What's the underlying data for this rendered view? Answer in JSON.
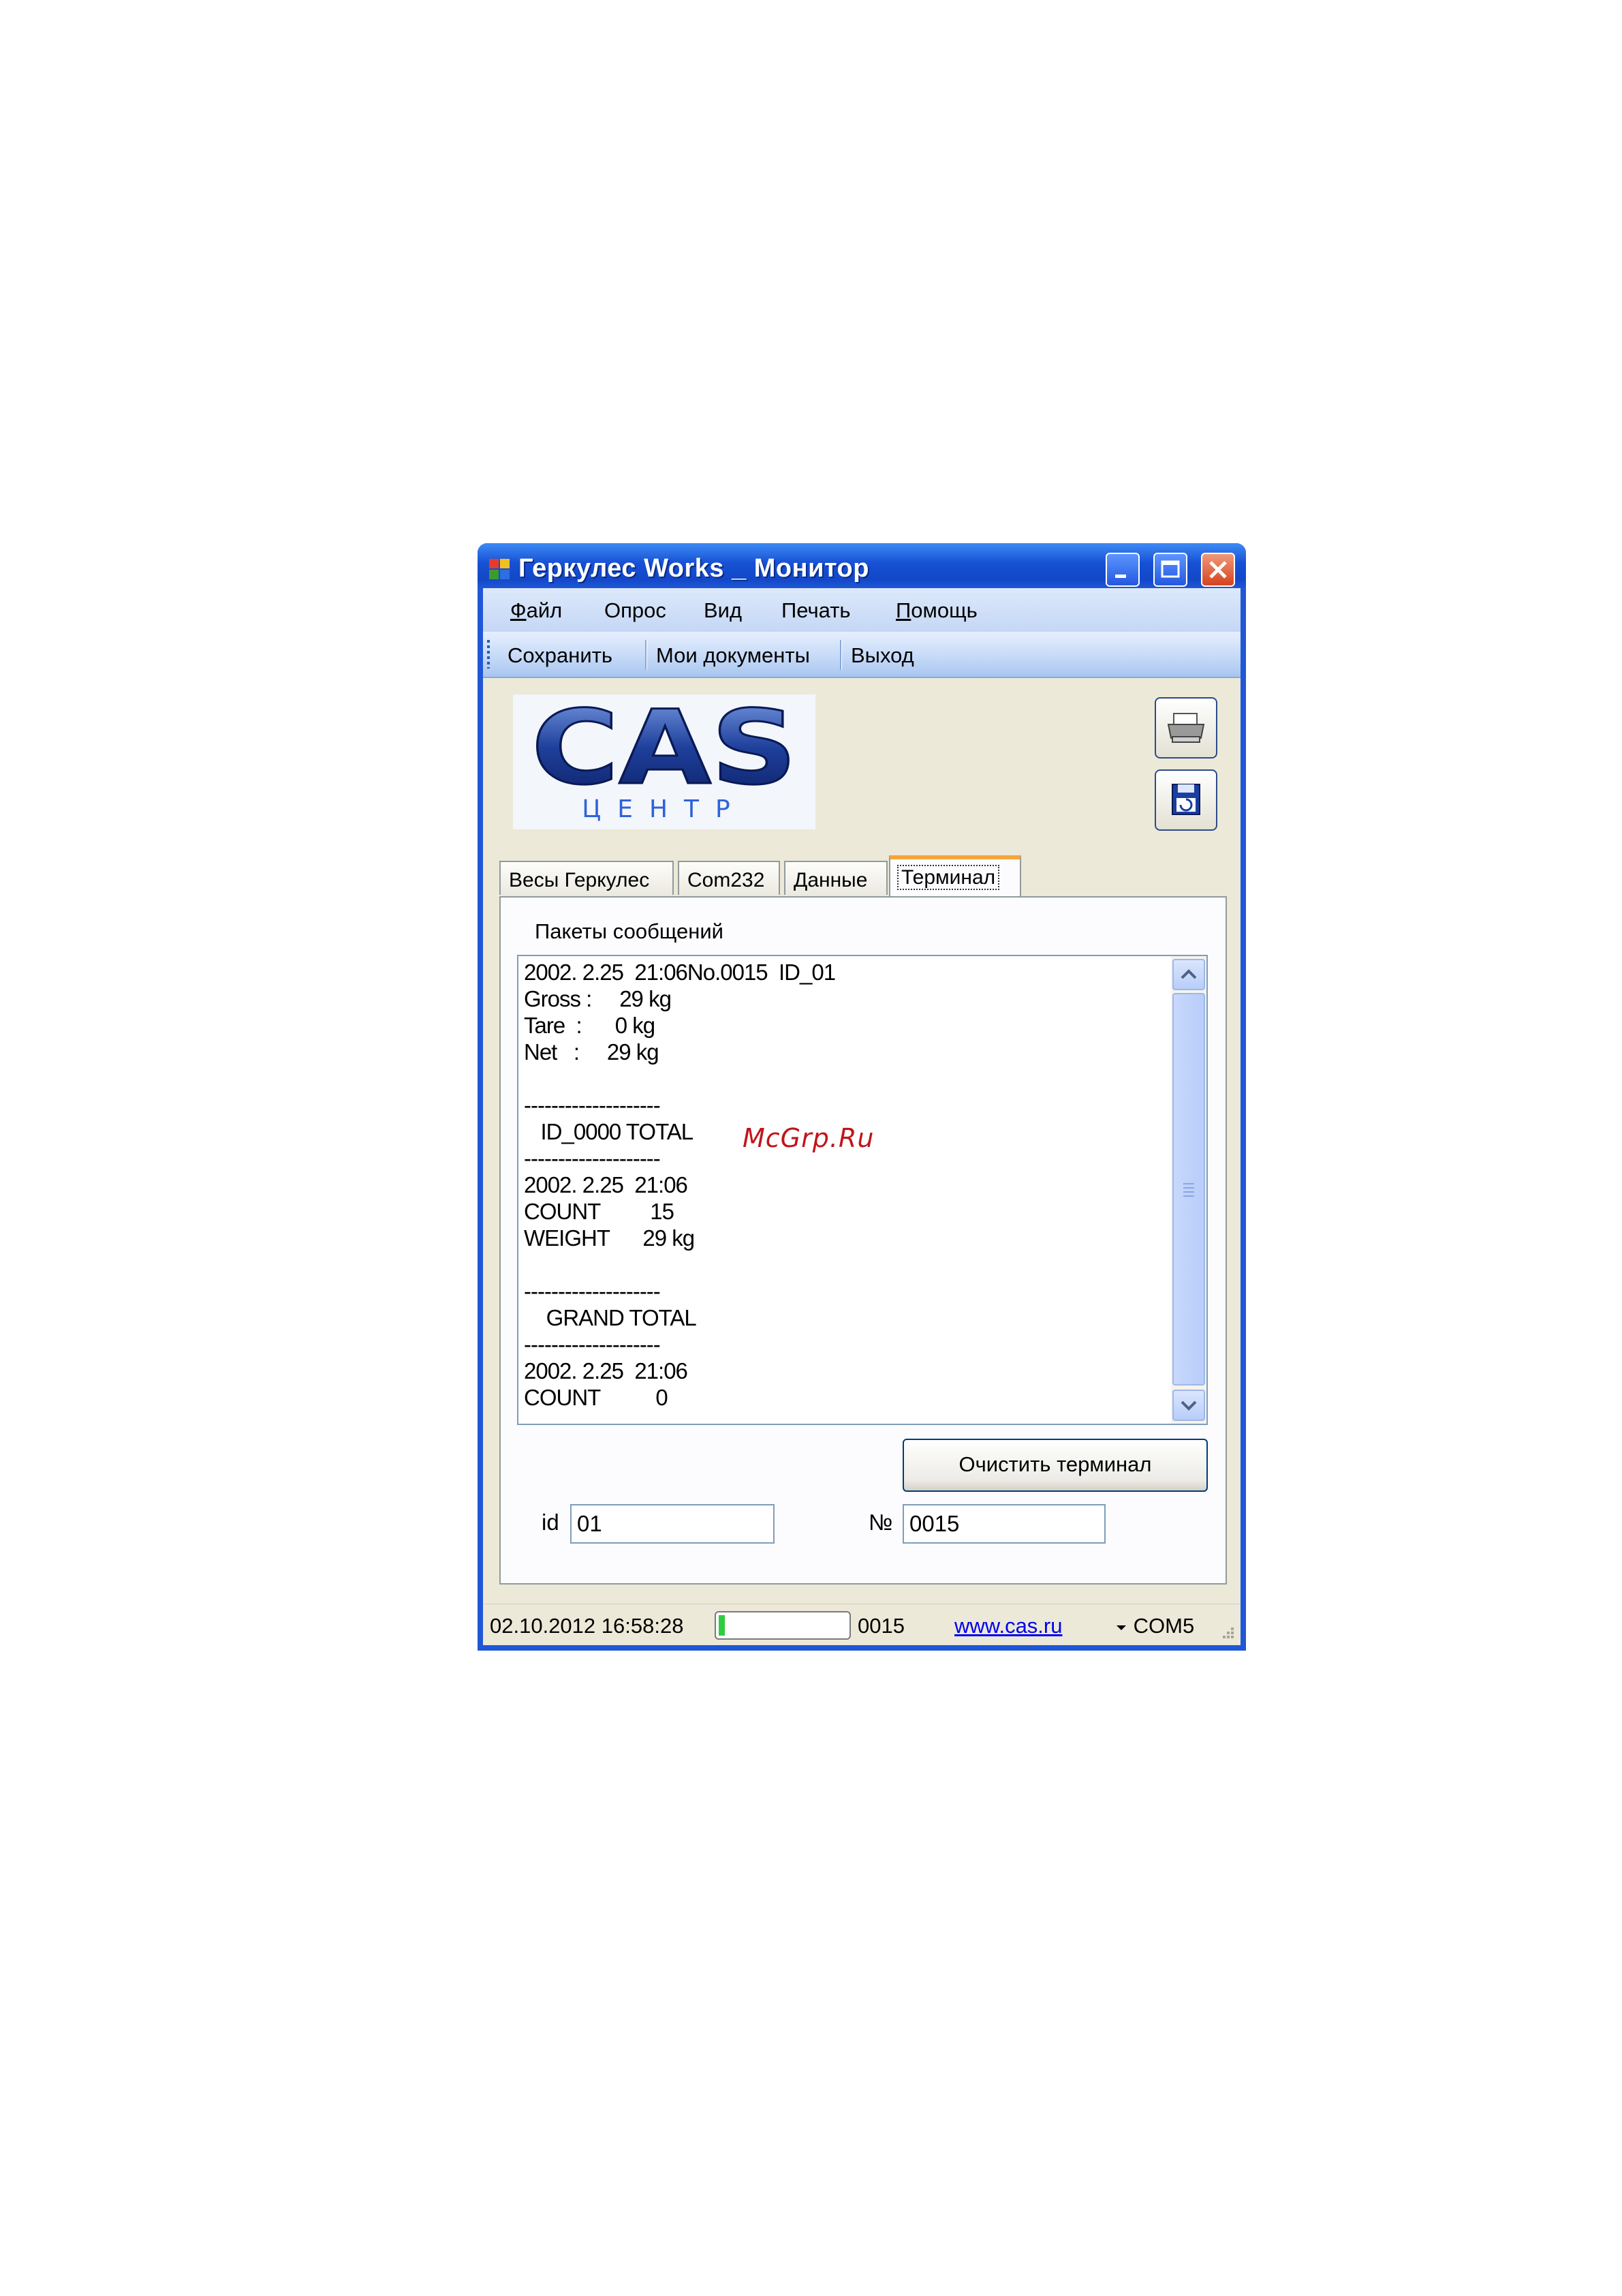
{
  "window": {
    "title": "Геркулес Works _ Монитор"
  },
  "menu": {
    "items": [
      {
        "underline": "Ф",
        "rest": "айл"
      },
      {
        "underline": "",
        "rest": "Опрос"
      },
      {
        "underline": "",
        "rest": "Вид"
      },
      {
        "underline": "",
        "rest": "Печать"
      },
      {
        "underline": "П",
        "rest": "омощь"
      }
    ]
  },
  "toolbar": {
    "save_label": "Сохранить",
    "docs_label": "Мои документы",
    "exit_label": "Выход"
  },
  "logo": {
    "brand": "CAS",
    "sub": "ЦЕНТР"
  },
  "tabs": [
    "Весы Геркулес",
    "Com232",
    "Данные",
    "Терминал"
  ],
  "terminal": {
    "group_label": "Пакеты сообщений",
    "log_lines": [
      "2002. 2.25  21:06No.0015  ID_01",
      "Gross :     29 kg",
      "Tare  :      0 kg",
      "Net   :     29 kg",
      "",
      "--------------------",
      "   ID_0000 TOTAL",
      "--------------------",
      "2002. 2.25  21:06",
      "COUNT         15",
      "WEIGHT      29 kg",
      "",
      "--------------------",
      "    GRAND TOTAL",
      "--------------------",
      "2002. 2.25  21:06",
      "COUNT          0"
    ],
    "clear_button": "Очистить терминал",
    "id_label": "id",
    "id_value": "01",
    "num_label": "№",
    "num_value": "0015"
  },
  "status": {
    "datetime": "02.10.2012 16:58:28",
    "progress_fraction": 0.05,
    "count": "0015",
    "link": "www.cas.ru",
    "port": "COM5"
  },
  "watermark": "McGrp.Ru",
  "colors": {
    "titlebar": "#1f57d6",
    "tab_accent": "#f7a43b",
    "progress": "#2ecc40",
    "close_button": "#d5421e"
  }
}
